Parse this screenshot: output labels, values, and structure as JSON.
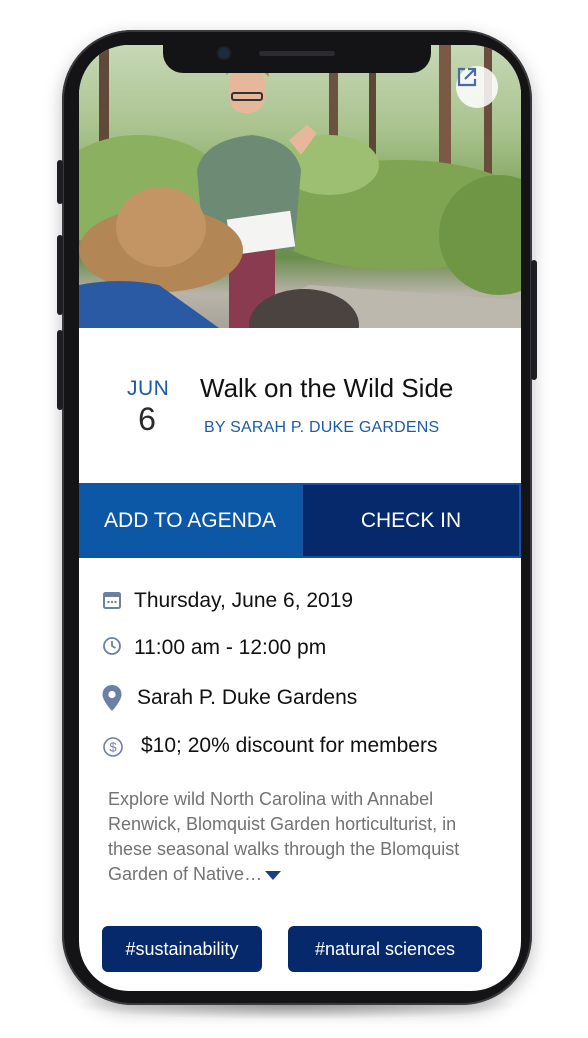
{
  "event": {
    "month": "JUN",
    "day": "6",
    "title": "Walk on the Wild Side",
    "organizer": "BY SARAH P. DUKE GARDENS"
  },
  "actions": {
    "add_to_agenda": "ADD TO AGENDA",
    "check_in": "CHECK IN"
  },
  "details": {
    "date": "Thursday, June 6, 2019",
    "time": "11:00 am - 12:00 pm",
    "location": "Sarah P. Duke Gardens",
    "price": "$10; 20% discount for members"
  },
  "description": "Explore wild North Carolina with Annabel Renwick, Blomquist Garden horticulturist, in these seasonal walks through the Blomquist Garden of Native…",
  "tags": [
    "#sustainability",
    "#natural sciences"
  ],
  "icons": {
    "share": "external-link-icon",
    "date": "calendar-icon",
    "time": "clock-icon",
    "location": "map-pin-icon",
    "price": "dollar-icon",
    "expand": "caret-down-icon"
  },
  "colors": {
    "primary_blue": "#0c58a6",
    "navy": "#05296a",
    "link_blue": "#1b5ca8",
    "icon_gray": "#6d7fa3"
  }
}
